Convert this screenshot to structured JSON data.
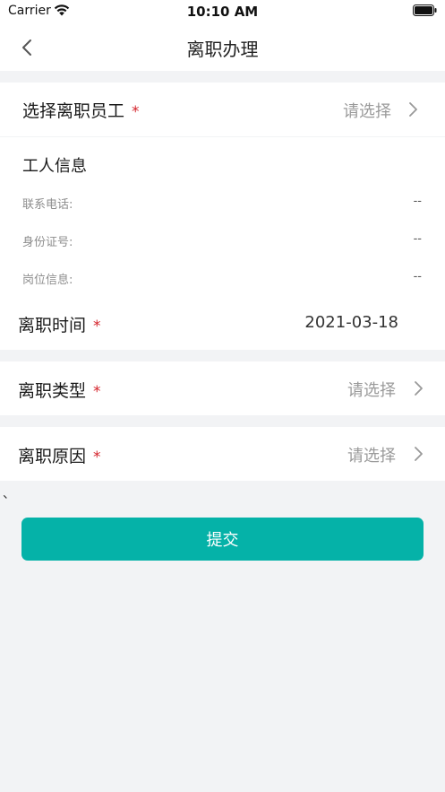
{
  "status_bar": {
    "carrier": "Carrier",
    "time": "10:10 AM"
  },
  "nav": {
    "title": "离职办理",
    "back_icon": "chevron-left-icon"
  },
  "employee_row": {
    "label": "选择离职员工",
    "required_mark": "*",
    "value": "请选择"
  },
  "worker_info": {
    "title": "工人信息",
    "fields": [
      {
        "label": "联系电话:",
        "value": "--"
      },
      {
        "label": "身份证号:",
        "value": "--"
      },
      {
        "label": "岗位信息:",
        "value": "--"
      }
    ]
  },
  "leave_time_row": {
    "label": "离职时间",
    "required_mark": "*",
    "value": "2021-03-18"
  },
  "leave_type_row": {
    "label": "离职类型",
    "required_mark": "*",
    "value": "请选择"
  },
  "leave_reason_row": {
    "label": "离职原因",
    "required_mark": "*",
    "value": "请选择"
  },
  "stray_mark": "、",
  "submit": {
    "label": "提交"
  },
  "colors": {
    "accent": "#05b2a8",
    "required": "#d4232b",
    "placeholder": "#9a9a9a",
    "background": "#f2f3f5"
  }
}
